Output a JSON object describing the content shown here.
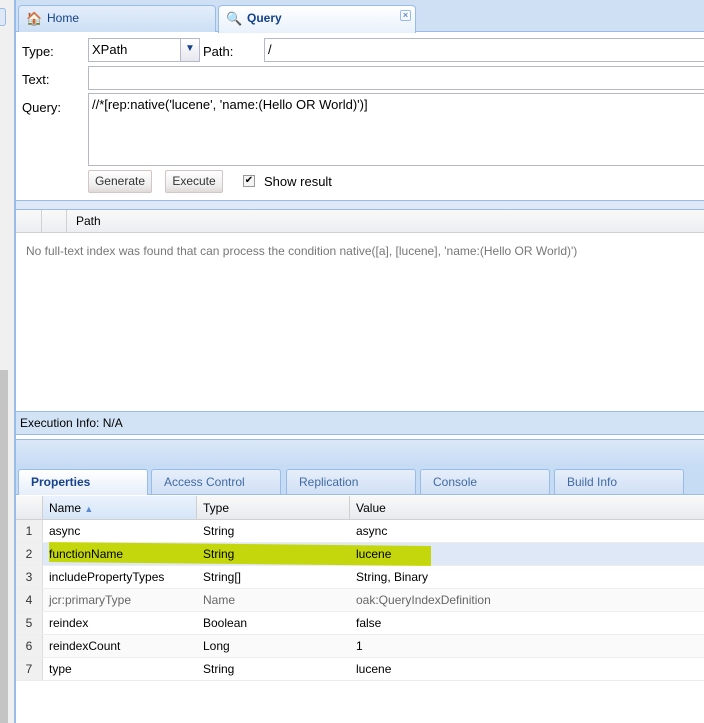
{
  "tabs": [
    {
      "label": "Home",
      "icon": "home-icon"
    },
    {
      "label": "Query",
      "icon": "magnifier-icon",
      "active": true
    }
  ],
  "form": {
    "type_label": "Type:",
    "type_value": "XPath",
    "path_label": "Path:",
    "path_value": "/",
    "text_label": "Text:",
    "text_value": "",
    "query_label": "Query:",
    "query_value": "//*[rep:native('lucene', 'name:(Hello OR World)')]",
    "generate_label": "Generate",
    "execute_label": "Execute",
    "show_result_label": "Show result",
    "show_result_checked": true
  },
  "results": {
    "column_path": "Path",
    "message": "No full-text index was found that can process the condition native([a], [lucene], 'name:(Hello OR World)')"
  },
  "execution_info": "Execution Info: N/A",
  "bottom_tabs": [
    "Properties",
    "Access Control",
    "Replication",
    "Console",
    "Build Info"
  ],
  "properties": {
    "columns": [
      "Name",
      "Type",
      "Value"
    ],
    "sort": "Name ascending",
    "rows": [
      {
        "n": "1",
        "name": "async",
        "type": "String",
        "value": "async"
      },
      {
        "n": "2",
        "name": "functionName",
        "type": "String",
        "value": "lucene"
      },
      {
        "n": "3",
        "name": "includePropertyTypes",
        "type": "String[]",
        "value": "String, Binary"
      },
      {
        "n": "4",
        "name": "jcr:primaryType",
        "type": "Name",
        "value": "oak:QueryIndexDefinition"
      },
      {
        "n": "5",
        "name": "reindex",
        "type": "Boolean",
        "value": "false"
      },
      {
        "n": "6",
        "name": "reindexCount",
        "type": "Long",
        "value": "1"
      },
      {
        "n": "7",
        "name": "type",
        "type": "String",
        "value": "lucene"
      }
    ],
    "highlight_color": "#e0ec00"
  }
}
